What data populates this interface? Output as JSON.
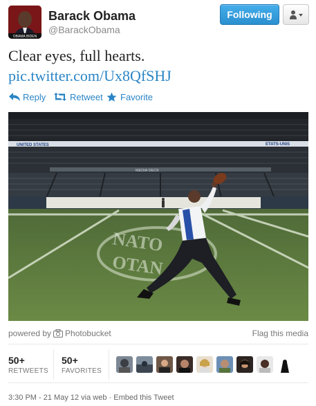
{
  "user": {
    "name": "Barack Obama",
    "handle": "@BarackObama",
    "avatar_caption": "OBAMA BIDEN"
  },
  "buttons": {
    "follow_label": "Following",
    "user_menu_icon": "user-dropdown-icon"
  },
  "tweet": {
    "text": "Clear eyes, full hearts.",
    "link": "pic.twitter.com/Ux8QfSHJ"
  },
  "actions": {
    "reply": "Reply",
    "retweet": "Retweet",
    "favorite": "Favorite"
  },
  "photo": {
    "signs": [
      "UNITED STATES",
      "MEDIA DECK",
      "ETATS-UNIS"
    ],
    "field_text": [
      "NATO",
      "OTAN"
    ]
  },
  "media": {
    "powered_prefix": "powered by",
    "provider": "Photobucket",
    "flag": "Flag this media"
  },
  "stats": {
    "retweets_count": "50+",
    "retweets_label": "RETWEETS",
    "favorites_count": "50+",
    "favorites_label": "FAVORITES"
  },
  "meta": {
    "timestamp": "3:30 PM - 21 May 12 via web",
    "separator": "·",
    "embed": "Embed this Tweet"
  },
  "colors": {
    "accent": "#2a85c6",
    "follow_button": "#2a8fd0"
  }
}
